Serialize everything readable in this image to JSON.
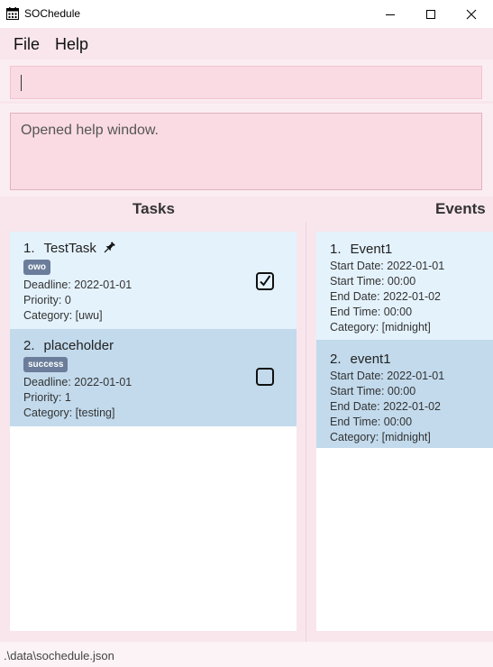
{
  "window": {
    "title": "SOChedule",
    "icon": "calendar-icon",
    "controls": [
      "minimize-icon",
      "maximize-icon",
      "close-icon"
    ]
  },
  "menu": {
    "file_label": "File",
    "help_label": "Help"
  },
  "command_box": {
    "value": "",
    "placeholder": ""
  },
  "result_display": {
    "text": "Opened help window."
  },
  "tasks": {
    "header": "Tasks",
    "items": [
      {
        "index": "1.",
        "name": "TestTask",
        "pinned": true,
        "tag": "owo",
        "deadline": "Deadline: 2022-01-01",
        "priority": "Priority: 0",
        "category": "Category: [uwu]",
        "completed": true
      },
      {
        "index": "2.",
        "name": "placeholder",
        "pinned": false,
        "tag": "success",
        "deadline": "Deadline: 2022-01-01",
        "priority": "Priority: 1",
        "category": "Category: [testing]",
        "completed": false
      }
    ]
  },
  "events": {
    "header": "Events",
    "items": [
      {
        "index": "1.",
        "name": "Event1",
        "start_date": "Start Date: 2022-01-01",
        "start_time": "Start Time: 00:00",
        "end_date": "End Date: 2022-01-02",
        "end_time": "End Time: 00:00",
        "category": "Category: [midnight]"
      },
      {
        "index": "2.",
        "name": "event1",
        "start_date": "Start Date: 2022-01-01",
        "start_time": "Start Time: 00:00",
        "end_date": "End Date: 2022-01-02",
        "end_time": "End Time: 00:00",
        "category": "Category: [midnight]"
      }
    ]
  },
  "status_bar": {
    "path": ".\\data\\sochedule.json"
  },
  "colors": {
    "background": "#f8e6ec",
    "input_background": "#fadbe3",
    "card_light": "#e4f2fc",
    "card_selected": "#c2daec",
    "tag": "#6b7d9a"
  }
}
